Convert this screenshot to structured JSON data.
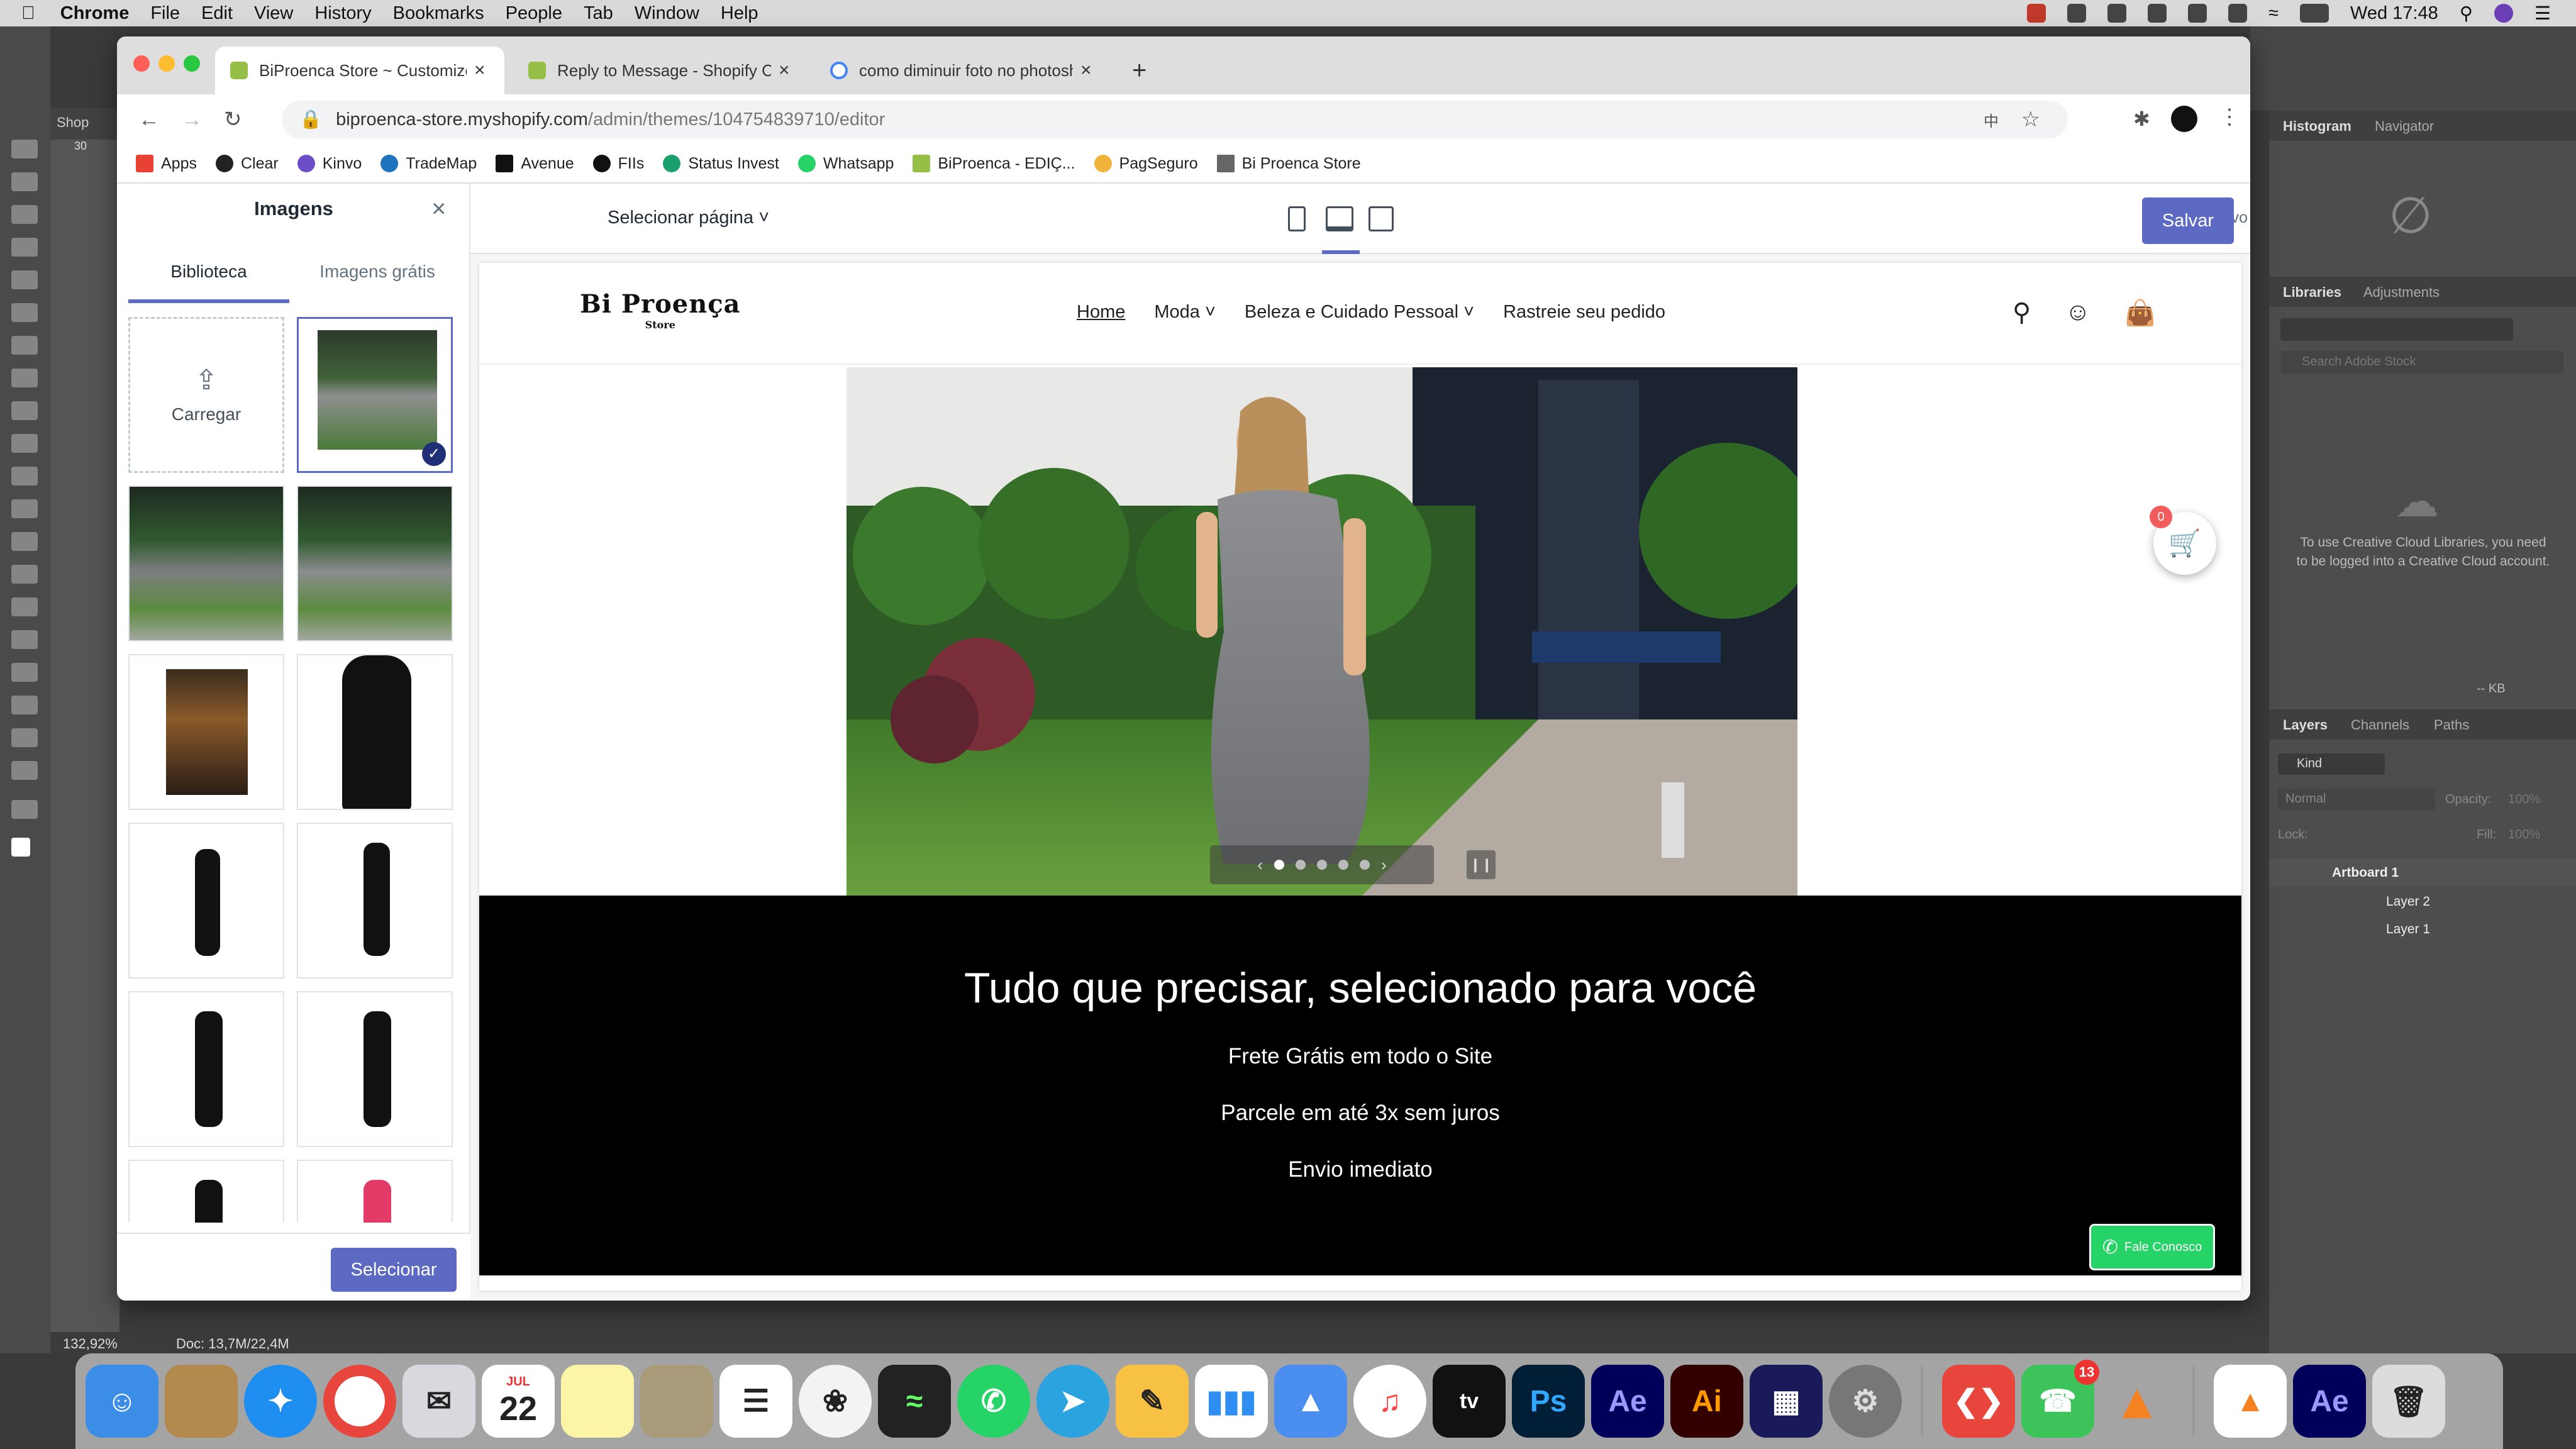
{
  "menubar": {
    "app": "Chrome",
    "items": [
      "File",
      "Edit",
      "View",
      "History",
      "Bookmarks",
      "People",
      "Tab",
      "Window",
      "Help"
    ],
    "clock": "Wed 17:48"
  },
  "photoshop": {
    "doc_tab": "Shop",
    "ruler_label": "30",
    "zoom": "132,92%",
    "doc_info": "Doc: 13,7M/22,4M",
    "panels": {
      "histogram": "Histogram",
      "navigator": "Navigator",
      "libraries": "Libraries",
      "adjustments": "Adjustments",
      "libraries_msg": "To use Creative Cloud Libraries, you need to be logged into a Creative Cloud account.",
      "kb": "-- KB",
      "layers": "Layers",
      "channels": "Channels",
      "paths": "Paths",
      "kind": "Kind",
      "blend": "Normal",
      "opacity_label": "Opacity:",
      "opacity": "100%",
      "lock_label": "Lock:",
      "fill_label": "Fill:",
      "fill": "100%",
      "search_placeholder": "Search Adobe Stock",
      "layer_items": [
        "Artboard 1",
        "Layer 2",
        "Layer 1"
      ]
    }
  },
  "browser": {
    "tabs": [
      "BiProenca Store ~ Customize",
      "Reply to Message - Shopify Co",
      "como diminuir foto no photosh"
    ],
    "url_domain": "biproenca-store.myshopify.com",
    "url_path": "/admin/themes/104754839710/editor",
    "bookmarks": [
      "Apps",
      "Clear",
      "Kinvo",
      "TradeMap",
      "Avenue",
      "FIIs",
      "Status Invest",
      "Whatsapp",
      "BiProenca - EDIÇ...",
      "PagSeguro",
      "Bi Proenca Store"
    ]
  },
  "editor": {
    "sidebar": {
      "title": "Imagens",
      "tab_library": "Biblioteca",
      "tab_free": "Imagens grátis",
      "upload": "Carregar",
      "select_button": "Selecionar"
    },
    "page_selector": "Selecionar página",
    "live": "Ao vivo",
    "save": "Salvar"
  },
  "store": {
    "logo_line1": "Bi Proença",
    "logo_line2": "Store",
    "nav": [
      "Home",
      "Moda",
      "Beleza e Cuidado Pessoal",
      "Rastreie seu pedido"
    ],
    "headline": "Tudo que precisar, selecionado para você",
    "lines": [
      "Frete Grátis em todo o Site",
      "Parcele em até 3x sem juros",
      "Envio imediato"
    ],
    "whatsapp": "Fale Conosco",
    "cart_count": "0",
    "calendar_month": "JUL",
    "calendar_day": "22",
    "facetime_badge": "13"
  }
}
